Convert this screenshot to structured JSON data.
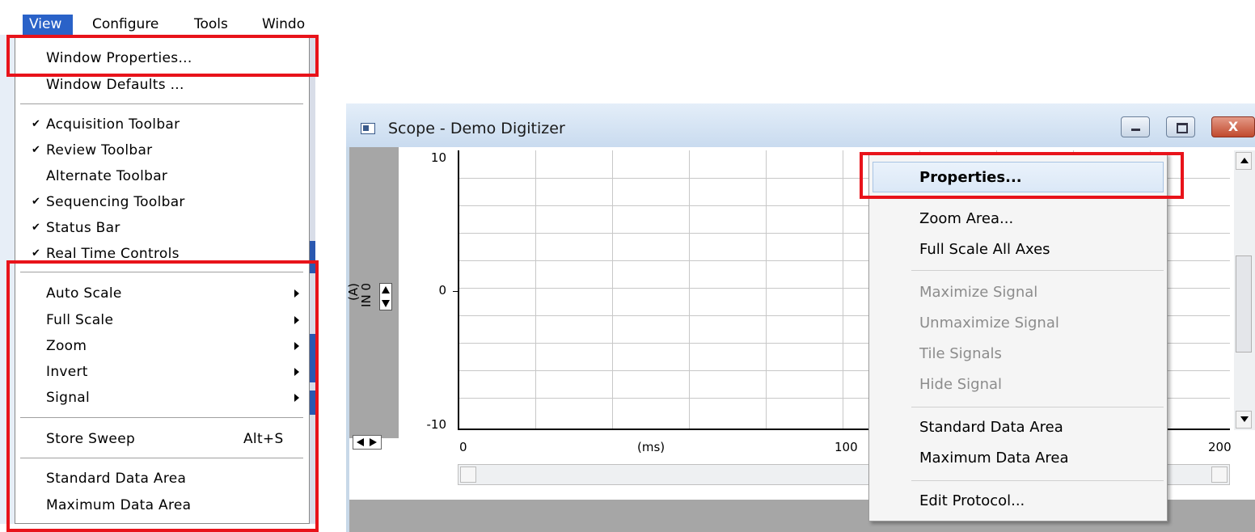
{
  "menubar": {
    "items": [
      {
        "label": "View"
      },
      {
        "label": "Configure"
      },
      {
        "label": "Tools"
      },
      {
        "label": "Windo"
      }
    ]
  },
  "view_menu": {
    "items": [
      {
        "label": "Window Properties..."
      },
      {
        "label": "Window Defaults ..."
      },
      {
        "label": "Acquisition Toolbar",
        "checked": true
      },
      {
        "label": "Review Toolbar",
        "checked": true
      },
      {
        "label": "Alternate Toolbar",
        "checked": false
      },
      {
        "label": "Sequencing Toolbar",
        "checked": true
      },
      {
        "label": "Status Bar",
        "checked": true
      },
      {
        "label": "Real Time Controls",
        "checked": true
      },
      {
        "label": "Auto Scale",
        "submenu": true
      },
      {
        "label": "Full Scale",
        "submenu": true
      },
      {
        "label": "Zoom",
        "submenu": true
      },
      {
        "label": "Invert",
        "submenu": true
      },
      {
        "label": "Signal",
        "submenu": true
      },
      {
        "label": "Store Sweep",
        "shortcut": "Alt+S"
      },
      {
        "label": "Standard Data Area"
      },
      {
        "label": "Maximum Data Area"
      }
    ],
    "check_glyph": "✔"
  },
  "scope_window": {
    "title": "Scope - Demo Digitizer",
    "close_glyph": "X",
    "signal_name": "IN 0",
    "signal_unit": "(A)",
    "y_ticks": [
      "10",
      "0",
      "-10"
    ],
    "x_ticks": [
      "0",
      "100",
      "200"
    ],
    "x_units": "(ms)"
  },
  "context_menu": {
    "items": [
      {
        "label": "Properties...",
        "bold": true,
        "highlighted": true
      },
      {
        "label": "Zoom Area..."
      },
      {
        "label": "Full Scale All Axes"
      },
      {
        "label": "Maximize Signal",
        "disabled": true
      },
      {
        "label": "Unmaximize Signal",
        "disabled": true
      },
      {
        "label": "Tile Signals",
        "disabled": true
      },
      {
        "label": "Hide Signal",
        "disabled": true
      },
      {
        "label": "Standard Data Area"
      },
      {
        "label": "Maximum Data Area"
      },
      {
        "label": "Edit Protocol..."
      }
    ]
  },
  "colors": {
    "highlight_box": "#e8131a",
    "menubar_selected": "#2a62c8",
    "disabled_text": "#8c8c8c"
  }
}
